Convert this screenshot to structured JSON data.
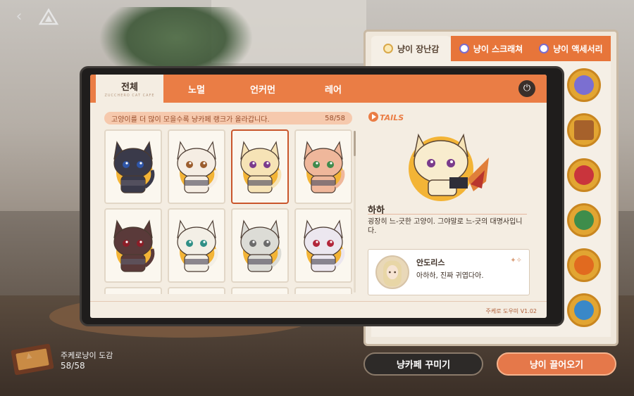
{
  "nav": {
    "back_icon": "‹"
  },
  "right_panel": {
    "tabs": [
      {
        "label": "냥이 장난감",
        "active": true
      },
      {
        "label": "냥이 스크래쳐",
        "active": false
      },
      {
        "label": "냥이 액세서리",
        "active": false
      }
    ],
    "toys": [
      {
        "name": "dolphin-toy",
        "color": "#7b6fd1"
      },
      {
        "name": "gift-box-toy",
        "color": "#a6612b"
      },
      {
        "name": "ball-toy",
        "color": "#c9343c"
      },
      {
        "name": "watermelon-toy",
        "color": "#3e8d4b"
      },
      {
        "name": "pumpkin-toy",
        "color": "#e16a1f"
      },
      {
        "name": "bird-toy",
        "color": "#3a88c8"
      }
    ]
  },
  "buttons": {
    "decorate": "냥카페 꾸미기",
    "bring": "냥이 끌어오기"
  },
  "book": {
    "title": "주케로냥이 도감",
    "count": "58/58"
  },
  "modal": {
    "tabs": [
      {
        "label": "전체",
        "sub": "ZUCCHERO CAT CAFE",
        "active": true
      },
      {
        "label": "노멀",
        "active": false
      },
      {
        "label": "언커먼",
        "active": false
      },
      {
        "label": "레어",
        "active": false
      }
    ],
    "power_icon": "⏻",
    "info_text": "고양이를 더 많이 모을수록 냥카페 랭크가 올라갑니다.",
    "info_count": "58/58",
    "cats": [
      {
        "fur": "#3a3a4a",
        "eyes": "#2f56a8",
        "selected": false
      },
      {
        "fur": "#f5ede3",
        "eyes": "#9b5d2e",
        "selected": false
      },
      {
        "fur": "#f6e3b6",
        "eyes": "#7a3b8c",
        "selected": true
      },
      {
        "fur": "#efb79b",
        "eyes": "#3f8a4c",
        "selected": false
      },
      {
        "fur": "#5a3a3a",
        "eyes": "#8c1e28",
        "selected": false
      },
      {
        "fur": "#f3efe6",
        "eyes": "#2f8f86",
        "selected": false
      },
      {
        "fur": "#dcdcd6",
        "eyes": "#6b6b6b",
        "selected": false
      },
      {
        "fur": "#ece7ef",
        "eyes": "#b2263a",
        "selected": false
      }
    ],
    "version": "주케로 도우미 V1.02",
    "details_logo": "TAILS",
    "detail": {
      "name": "하하",
      "desc": "굉장히 느-긋한 고양이. 그야말로 느-긋의 대명사입니다.",
      "commenter": "안도리스",
      "comment": "아하하, 진짜 귀엽다아."
    }
  }
}
